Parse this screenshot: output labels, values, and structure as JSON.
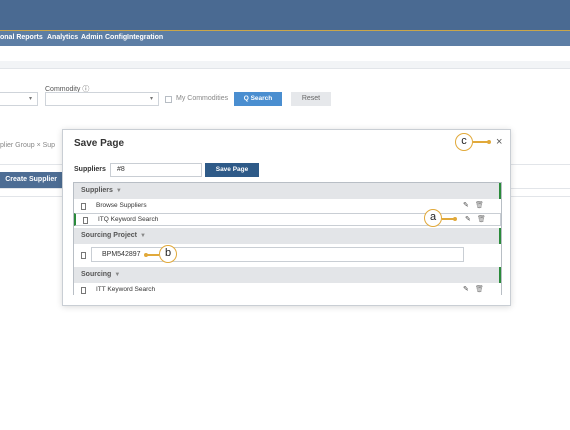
{
  "nav": {
    "items": [
      "onal Reports",
      "Analytics",
      "Admin",
      "Config",
      "Integration"
    ]
  },
  "filters": {
    "commodity_label": "Commodity ⓘ",
    "my_commodities_label": "My Commodities",
    "search_label": "Q Search",
    "reset_label": "Reset"
  },
  "background": {
    "filter_chip": "plier Group  ×   Sup",
    "create_supplier_label": "Create Supplier"
  },
  "modal": {
    "title": "Save Page",
    "close": "×",
    "field_label": "Suppliers",
    "field_value": "#8",
    "save_button_label": "Save Page",
    "sections": [
      {
        "title": "Suppliers",
        "items": [
          "Browse Suppliers",
          "ITQ Keyword Search"
        ]
      },
      {
        "title": "Sourcing Project",
        "edit_value": "BPM542897"
      },
      {
        "title": "Sourcing",
        "items": [
          "ITT Keyword Search"
        ]
      }
    ],
    "section_caret": "▼",
    "edit_icon_glyph": "✎",
    "delete_icon_glyph": "🗑",
    "doc_icon": "document-icon"
  },
  "callouts": {
    "a": "a",
    "b": "b",
    "c": "c"
  },
  "colors": {
    "topbar": "#4a6a92",
    "navbar": "#5d7ea5",
    "accent_green": "#2a8a3a",
    "save_button": "#2e5a88",
    "callout": "#e1a93a"
  }
}
